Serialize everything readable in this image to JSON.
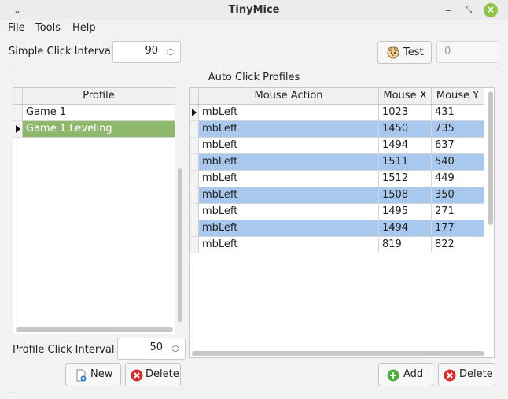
{
  "window": {
    "title": "TinyMice",
    "menu_icon": "chevron-down",
    "minimize_icon": "minimize",
    "restore_icon": "restore",
    "close_icon": "close"
  },
  "menu": {
    "file": "File",
    "tools": "Tools",
    "help": "Help"
  },
  "simple_click": {
    "label": "Simple Click Interval :",
    "value": "90"
  },
  "test": {
    "label": "Test",
    "icon": "mouse-icon",
    "result_value": "0"
  },
  "group_title": "Auto Click Profiles",
  "profiles": {
    "header": "Profile",
    "items": [
      {
        "name": "Game 1",
        "selected": false
      },
      {
        "name": "Game 1 Leveling",
        "selected": true
      }
    ],
    "interval_label": "Profile Click Interval :",
    "interval_value": "50",
    "new_label": "New",
    "delete_label": "Delete"
  },
  "actions": {
    "headers": {
      "action": "Mouse Action",
      "x": "Mouse X",
      "y": "Mouse Y"
    },
    "rows": [
      {
        "action": "mbLeft",
        "x": "1023",
        "y": "431"
      },
      {
        "action": "mbLeft",
        "x": "1450",
        "y": "735"
      },
      {
        "action": "mbLeft",
        "x": "1494",
        "y": "637"
      },
      {
        "action": "mbLeft",
        "x": "1511",
        "y": "540"
      },
      {
        "action": "mbLeft",
        "x": "1512",
        "y": "449"
      },
      {
        "action": "mbLeft",
        "x": "1508",
        "y": "350"
      },
      {
        "action": "mbLeft",
        "x": "1495",
        "y": "271"
      },
      {
        "action": "mbLeft",
        "x": "1494",
        "y": "177"
      },
      {
        "action": "mbLeft",
        "x": "819",
        "y": "822"
      }
    ],
    "add_label": "Add",
    "delete_label": "Delete"
  },
  "colors": {
    "selected_profile": "#8fb86e",
    "alt_row": "#a9c8ee",
    "accent_green": "#4caf3a",
    "accent_red": "#d32f2f"
  }
}
